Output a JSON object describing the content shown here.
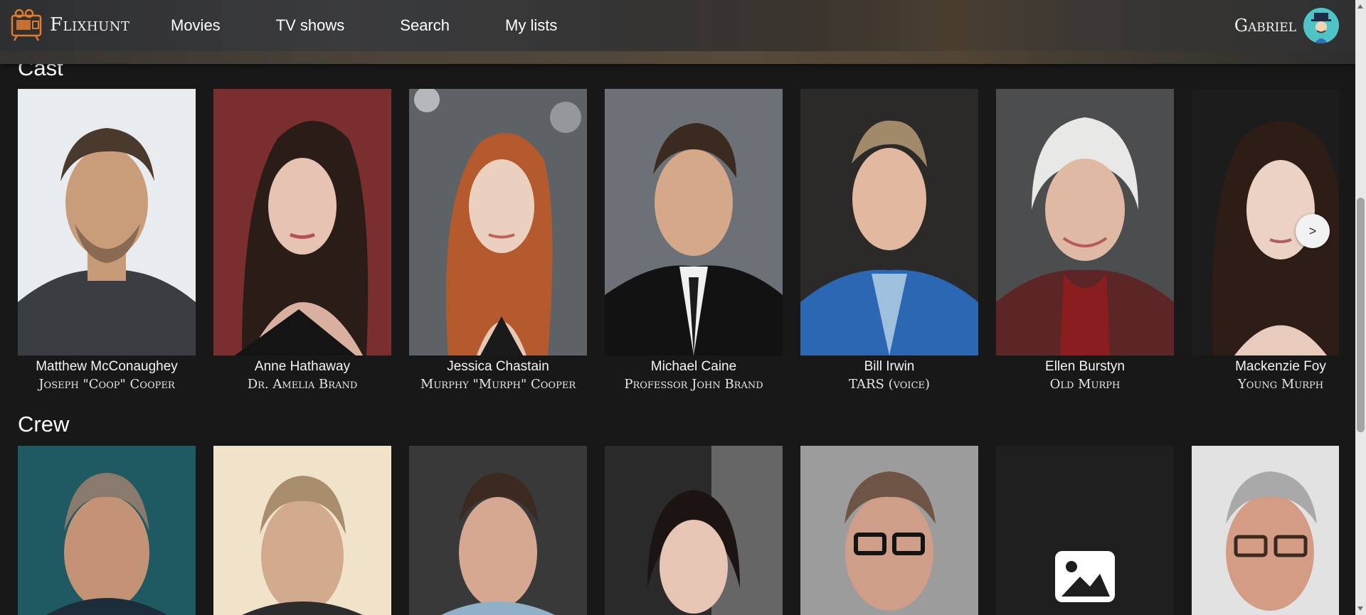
{
  "app": {
    "name": "Flixhunt"
  },
  "nav": {
    "items": [
      "Movies",
      "TV shows",
      "Search",
      "My lists"
    ]
  },
  "user": {
    "name": "Gabriel"
  },
  "cast": {
    "title": "Cast",
    "members": [
      {
        "name": "Matthew McConaughey",
        "role": "Joseph \"Coop\" Cooper"
      },
      {
        "name": "Anne Hathaway",
        "role": "Dr. Amelia Brand"
      },
      {
        "name": "Jessica Chastain",
        "role": "Murphy \"Murph\" Cooper"
      },
      {
        "name": "Michael Caine",
        "role": "Professor John Brand"
      },
      {
        "name": "Bill Irwin",
        "role": "TARS (voice)"
      },
      {
        "name": "Ellen Burstyn",
        "role": "Old Murph"
      },
      {
        "name": "Mackenzie Foy",
        "role": "Young Murph"
      }
    ],
    "next_label": ">"
  },
  "crew": {
    "title": "Crew"
  },
  "colors": {
    "background": "#181818",
    "header": "#333333",
    "accent_logo": "#e07a2e",
    "avatar": "#4fc3c6"
  }
}
